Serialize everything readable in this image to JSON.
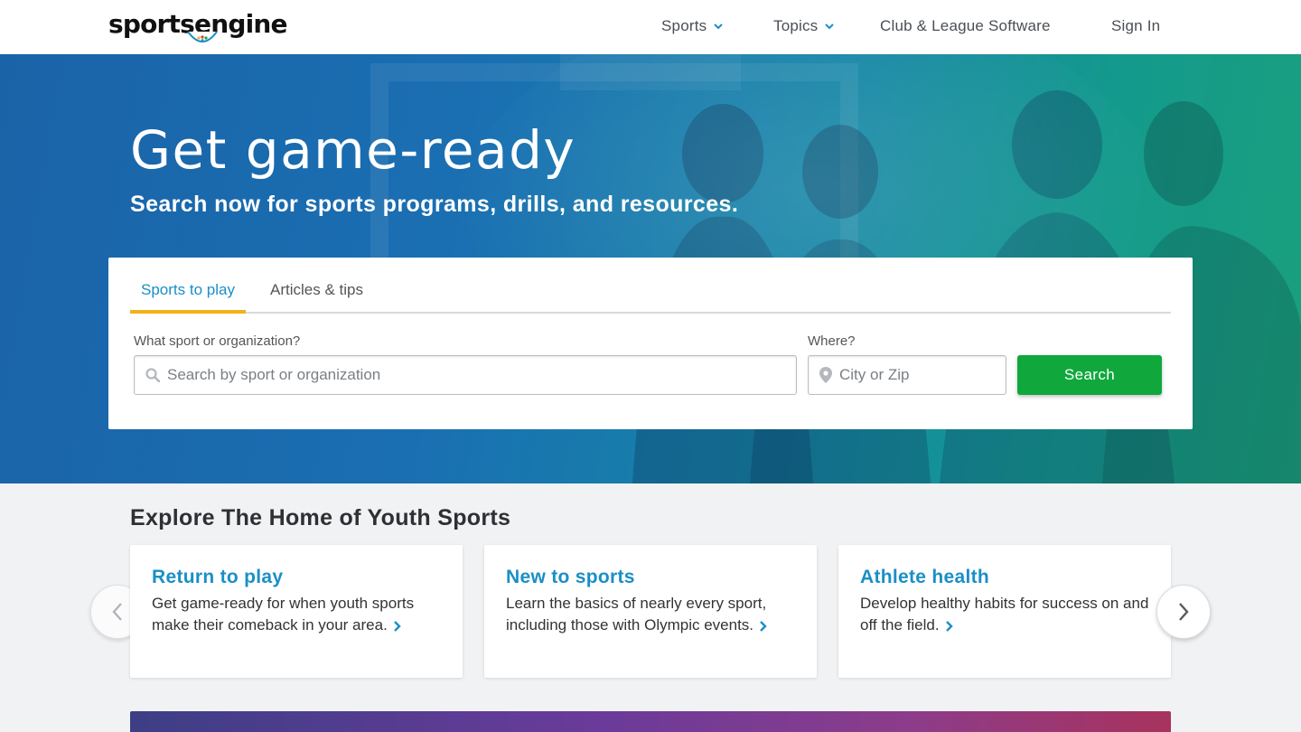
{
  "brand": {
    "logo_text_a": "sports",
    "logo_text_b": "e",
    "logo_text_c": "ngine"
  },
  "nav": {
    "items": [
      {
        "label": "Sports",
        "has_dropdown": true
      },
      {
        "label": "Topics",
        "has_dropdown": true
      },
      {
        "label": "Club & League Software",
        "has_dropdown": false
      },
      {
        "label": "Sign In",
        "has_dropdown": false
      }
    ]
  },
  "hero": {
    "title": "Get game-ready",
    "subtitle": "Search now for sports programs, drills, and resources."
  },
  "search": {
    "tabs": [
      {
        "label": "Sports to play",
        "active": true
      },
      {
        "label": "Articles & tips",
        "active": false
      }
    ],
    "sport_label": "What sport or organization?",
    "sport_placeholder": "Search by sport or organization",
    "where_label": "Where?",
    "where_placeholder": "City or Zip",
    "button_label": "Search"
  },
  "explore": {
    "title": "Explore The Home of Youth Sports",
    "cards": [
      {
        "title": "Return to play",
        "text": "Get game-ready for when youth sports make their comeback in your area."
      },
      {
        "title": "New to sports",
        "text": "Learn the basics of nearly every sport, including those with Olympic events."
      },
      {
        "title": "Athlete health",
        "text": "Develop healthy habits for success on and off the field."
      }
    ]
  },
  "colors": {
    "accent_blue": "#1a8fc6",
    "tab_underline": "#f2b21b",
    "search_green": "#10a83d",
    "hero_start": "#1b63a8",
    "hero_end": "#1aa07c"
  },
  "icons": {
    "nav_dropdown": "chevron-down-icon",
    "sport_field": "search-icon",
    "where_field": "map-pin-icon",
    "card_link": "chevron-right-icon",
    "carousel_prev": "chevron-left-icon",
    "carousel_next": "chevron-right-icon",
    "logo_mark": "peacock-icon"
  }
}
